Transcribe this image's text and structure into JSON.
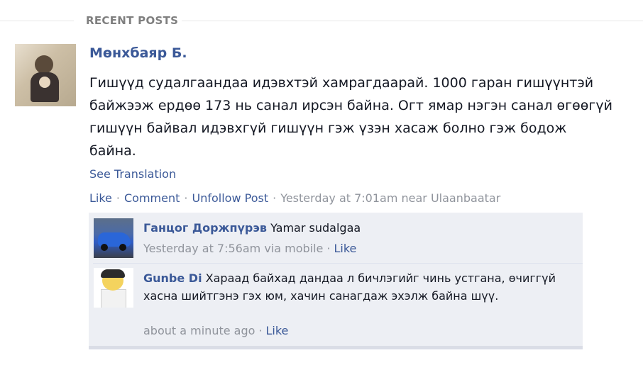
{
  "section": {
    "title": "RECENT POSTS"
  },
  "post": {
    "author": "Мөнхбаяр Б.",
    "text": "Гишүүд судалгаандаа идэвхтэй хамрагдаарай. 1000 гаран гишүүнтэй байжээж ердөө 173 нь санал ирсэн байна. Огт ямар нэгэн санал өгөөгүй гишүүн байвал идэвхгүй гишүүн гэж үзэн хасаж болно гэж бодож байна.",
    "see_translation": "See Translation",
    "actions": {
      "like": "Like",
      "comment": "Comment",
      "unfollow": "Unfollow Post",
      "separator": "·",
      "timestamp": "Yesterday at 7:01am near Ulaanbaatar"
    }
  },
  "comments": [
    {
      "author": "Ганцог Доржпүрэв",
      "text": "Yamar sudalgaa",
      "meta": "Yesterday at 7:56am via mobile",
      "like": "Like"
    },
    {
      "author": "Gunbe Di",
      "text": "Хараад байхад дандаа л бичлэгийг чинь устгана, өчиггүй хасна шийтгэнэ гэх юм, хачин санагдаж эхэлж байна шүү.",
      "meta": "about a minute ago",
      "like": "Like"
    }
  ]
}
